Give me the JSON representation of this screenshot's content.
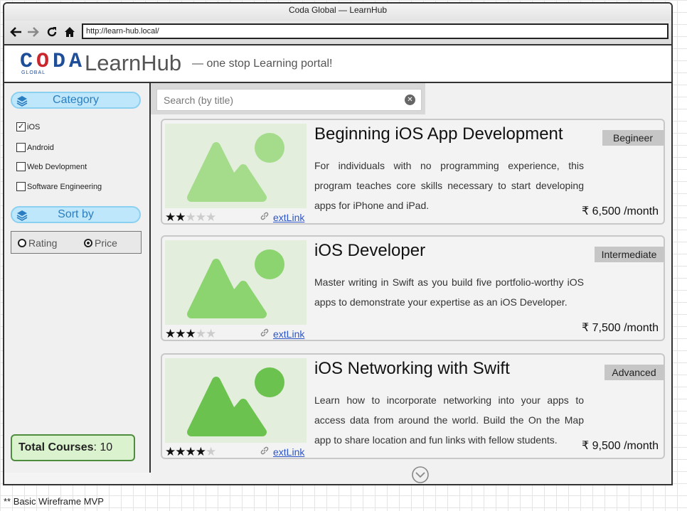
{
  "window": {
    "title": "Coda Global — LearnHub"
  },
  "browser": {
    "url": "http://learn-hub.local/"
  },
  "header": {
    "logo_letters": [
      "C",
      "O",
      "D",
      "A"
    ],
    "logo_sub": "GLOBAL",
    "app_title": "LearnHub",
    "tagline": "— one stop Learning portal!",
    "brand_colors": {
      "blue": "#1f4e99",
      "red": "#c9262d"
    }
  },
  "sidebar": {
    "category_label": "Category",
    "categories": [
      {
        "label": "iOS",
        "checked": true
      },
      {
        "label": "Android",
        "checked": false
      },
      {
        "label": "Web Devlopment",
        "checked": false
      },
      {
        "label": "Software Engineering",
        "checked": false
      }
    ],
    "sort_label": "Sort by",
    "sort_options": [
      {
        "label": "Rating",
        "selected": false
      },
      {
        "label": "Price",
        "selected": true
      }
    ],
    "total_label": "Total Courses",
    "total_value": ": 10"
  },
  "search": {
    "placeholder": "Search (by title)"
  },
  "courses": [
    {
      "title": "Beginning iOS App Development",
      "level": "Begineer",
      "description": "For individuals with no programming experience, this program teaches core skills necessary to start developing apps for iPhone and iPad.",
      "price": "₹ 6,500 /month",
      "rating": 2,
      "rating_max": 5,
      "link_label": "extLink",
      "thumb_color": "#a5dc8c"
    },
    {
      "title": "iOS Developer",
      "level": "Intermediate",
      "description": "Master writing in Swift as you build five portfolio-worthy iOS apps to demonstrate your expertise as an iOS Developer.",
      "price": "₹ 7,500 /month",
      "rating": 3,
      "rating_max": 5,
      "link_label": "extLink",
      "thumb_color": "#8bd46f"
    },
    {
      "title": "iOS Networking with Swift",
      "level": "Advanced",
      "description": "Learn how to incorporate networking into your apps to access data from around the world. Build the On the Map app to share location and fun links with fellow students.",
      "price": "₹ 9,500 /month",
      "rating": 4,
      "rating_max": 5,
      "link_label": "extLink",
      "thumb_color": "#6cc24f"
    }
  ],
  "footer_note": "** Basic Wireframe MVP"
}
